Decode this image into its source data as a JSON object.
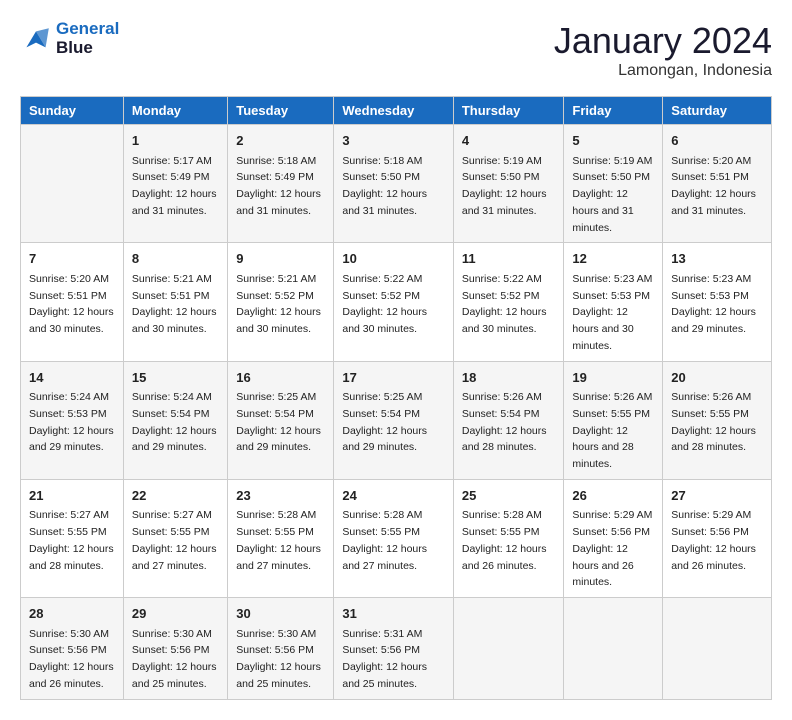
{
  "header": {
    "logo_line1": "General",
    "logo_line2": "Blue",
    "month": "January 2024",
    "location": "Lamongan, Indonesia"
  },
  "weekdays": [
    "Sunday",
    "Monday",
    "Tuesday",
    "Wednesday",
    "Thursday",
    "Friday",
    "Saturday"
  ],
  "weeks": [
    [
      {
        "day": "",
        "sunrise": "",
        "sunset": "",
        "daylight": ""
      },
      {
        "day": "1",
        "sunrise": "Sunrise: 5:17 AM",
        "sunset": "Sunset: 5:49 PM",
        "daylight": "Daylight: 12 hours and 31 minutes."
      },
      {
        "day": "2",
        "sunrise": "Sunrise: 5:18 AM",
        "sunset": "Sunset: 5:49 PM",
        "daylight": "Daylight: 12 hours and 31 minutes."
      },
      {
        "day": "3",
        "sunrise": "Sunrise: 5:18 AM",
        "sunset": "Sunset: 5:50 PM",
        "daylight": "Daylight: 12 hours and 31 minutes."
      },
      {
        "day": "4",
        "sunrise": "Sunrise: 5:19 AM",
        "sunset": "Sunset: 5:50 PM",
        "daylight": "Daylight: 12 hours and 31 minutes."
      },
      {
        "day": "5",
        "sunrise": "Sunrise: 5:19 AM",
        "sunset": "Sunset: 5:50 PM",
        "daylight": "Daylight: 12 hours and 31 minutes."
      },
      {
        "day": "6",
        "sunrise": "Sunrise: 5:20 AM",
        "sunset": "Sunset: 5:51 PM",
        "daylight": "Daylight: 12 hours and 31 minutes."
      }
    ],
    [
      {
        "day": "7",
        "sunrise": "Sunrise: 5:20 AM",
        "sunset": "Sunset: 5:51 PM",
        "daylight": "Daylight: 12 hours and 30 minutes."
      },
      {
        "day": "8",
        "sunrise": "Sunrise: 5:21 AM",
        "sunset": "Sunset: 5:51 PM",
        "daylight": "Daylight: 12 hours and 30 minutes."
      },
      {
        "day": "9",
        "sunrise": "Sunrise: 5:21 AM",
        "sunset": "Sunset: 5:52 PM",
        "daylight": "Daylight: 12 hours and 30 minutes."
      },
      {
        "day": "10",
        "sunrise": "Sunrise: 5:22 AM",
        "sunset": "Sunset: 5:52 PM",
        "daylight": "Daylight: 12 hours and 30 minutes."
      },
      {
        "day": "11",
        "sunrise": "Sunrise: 5:22 AM",
        "sunset": "Sunset: 5:52 PM",
        "daylight": "Daylight: 12 hours and 30 minutes."
      },
      {
        "day": "12",
        "sunrise": "Sunrise: 5:23 AM",
        "sunset": "Sunset: 5:53 PM",
        "daylight": "Daylight: 12 hours and 30 minutes."
      },
      {
        "day": "13",
        "sunrise": "Sunrise: 5:23 AM",
        "sunset": "Sunset: 5:53 PM",
        "daylight": "Daylight: 12 hours and 29 minutes."
      }
    ],
    [
      {
        "day": "14",
        "sunrise": "Sunrise: 5:24 AM",
        "sunset": "Sunset: 5:53 PM",
        "daylight": "Daylight: 12 hours and 29 minutes."
      },
      {
        "day": "15",
        "sunrise": "Sunrise: 5:24 AM",
        "sunset": "Sunset: 5:54 PM",
        "daylight": "Daylight: 12 hours and 29 minutes."
      },
      {
        "day": "16",
        "sunrise": "Sunrise: 5:25 AM",
        "sunset": "Sunset: 5:54 PM",
        "daylight": "Daylight: 12 hours and 29 minutes."
      },
      {
        "day": "17",
        "sunrise": "Sunrise: 5:25 AM",
        "sunset": "Sunset: 5:54 PM",
        "daylight": "Daylight: 12 hours and 29 minutes."
      },
      {
        "day": "18",
        "sunrise": "Sunrise: 5:26 AM",
        "sunset": "Sunset: 5:54 PM",
        "daylight": "Daylight: 12 hours and 28 minutes."
      },
      {
        "day": "19",
        "sunrise": "Sunrise: 5:26 AM",
        "sunset": "Sunset: 5:55 PM",
        "daylight": "Daylight: 12 hours and 28 minutes."
      },
      {
        "day": "20",
        "sunrise": "Sunrise: 5:26 AM",
        "sunset": "Sunset: 5:55 PM",
        "daylight": "Daylight: 12 hours and 28 minutes."
      }
    ],
    [
      {
        "day": "21",
        "sunrise": "Sunrise: 5:27 AM",
        "sunset": "Sunset: 5:55 PM",
        "daylight": "Daylight: 12 hours and 28 minutes."
      },
      {
        "day": "22",
        "sunrise": "Sunrise: 5:27 AM",
        "sunset": "Sunset: 5:55 PM",
        "daylight": "Daylight: 12 hours and 27 minutes."
      },
      {
        "day": "23",
        "sunrise": "Sunrise: 5:28 AM",
        "sunset": "Sunset: 5:55 PM",
        "daylight": "Daylight: 12 hours and 27 minutes."
      },
      {
        "day": "24",
        "sunrise": "Sunrise: 5:28 AM",
        "sunset": "Sunset: 5:55 PM",
        "daylight": "Daylight: 12 hours and 27 minutes."
      },
      {
        "day": "25",
        "sunrise": "Sunrise: 5:28 AM",
        "sunset": "Sunset: 5:55 PM",
        "daylight": "Daylight: 12 hours and 26 minutes."
      },
      {
        "day": "26",
        "sunrise": "Sunrise: 5:29 AM",
        "sunset": "Sunset: 5:56 PM",
        "daylight": "Daylight: 12 hours and 26 minutes."
      },
      {
        "day": "27",
        "sunrise": "Sunrise: 5:29 AM",
        "sunset": "Sunset: 5:56 PM",
        "daylight": "Daylight: 12 hours and 26 minutes."
      }
    ],
    [
      {
        "day": "28",
        "sunrise": "Sunrise: 5:30 AM",
        "sunset": "Sunset: 5:56 PM",
        "daylight": "Daylight: 12 hours and 26 minutes."
      },
      {
        "day": "29",
        "sunrise": "Sunrise: 5:30 AM",
        "sunset": "Sunset: 5:56 PM",
        "daylight": "Daylight: 12 hours and 25 minutes."
      },
      {
        "day": "30",
        "sunrise": "Sunrise: 5:30 AM",
        "sunset": "Sunset: 5:56 PM",
        "daylight": "Daylight: 12 hours and 25 minutes."
      },
      {
        "day": "31",
        "sunrise": "Sunrise: 5:31 AM",
        "sunset": "Sunset: 5:56 PM",
        "daylight": "Daylight: 12 hours and 25 minutes."
      },
      {
        "day": "",
        "sunrise": "",
        "sunset": "",
        "daylight": ""
      },
      {
        "day": "",
        "sunrise": "",
        "sunset": "",
        "daylight": ""
      },
      {
        "day": "",
        "sunrise": "",
        "sunset": "",
        "daylight": ""
      }
    ]
  ]
}
